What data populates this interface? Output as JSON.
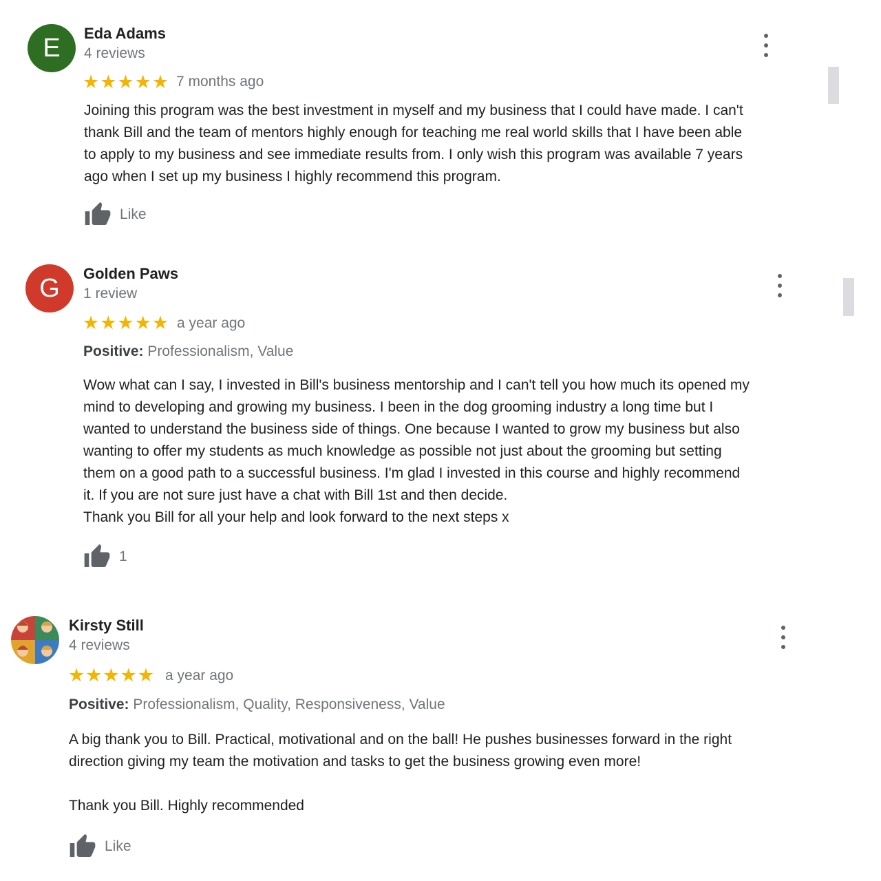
{
  "colors": {
    "star": "#f4b400",
    "secondary_text": "#70757a",
    "avatar_e": "#2e7d32",
    "avatar_g": "#d93025"
  },
  "reviews": [
    {
      "avatar_letter": "E",
      "name": "Eda Adams",
      "review_count": "4 reviews",
      "stars": "★★★★★",
      "rating": 5,
      "time": "7 months ago",
      "text": "Joining this program was the best investment in myself and my business that I could have made. I can't\nthank Bill and the team of mentors highly enough for teaching me real world skills that I have been able\nto apply to my business and see immediate results from. I only wish this program was available 7 years\nago when I set up my business I highly recommend this program.",
      "like_label": "Like",
      "menu_icon": "more-vert-icon",
      "like_icon": "thumb-up-icon"
    },
    {
      "avatar_letter": "G",
      "name": "Golden Paws",
      "review_count": "1 review",
      "stars": "★★★★★",
      "rating": 5,
      "time": "a year ago",
      "positive_label": "Positive:",
      "positive_values": "Professionalism, Value",
      "text": "Wow what can I say, I invested in Bill's business mentorship and I can't tell you how much its opened my\nmind to developing and growing my business. I been in the dog grooming industry a long time but I\nwanted to understand the business side of things. One because I wanted to grow my business but also\nwanting to offer my students as much knowledge as possible not just about the grooming but setting\nthem on a good path to a successful business. I'm glad I invested in this course and highly recommend\nit. If you are not sure just have a chat with Bill 1st and then decide.\nThank you Bill for all your help and look forward to the next steps x",
      "like_label": "1",
      "menu_icon": "more-vert-icon",
      "like_icon": "thumb-up-icon"
    },
    {
      "name": "Kirsty Still",
      "review_count": "4 reviews",
      "stars": "★★★★★",
      "rating": 5,
      "time": "a year ago",
      "positive_label": "Positive:",
      "positive_values": "Professionalism, Quality, Responsiveness, Value",
      "text": "A big thank you to Bill. Practical, motivational and on the ball! He pushes businesses forward in the right\ndirection giving my team the motivation and tasks to get the business growing even more!\n\nThank you Bill. Highly recommended",
      "like_label": "Like",
      "menu_icon": "more-vert-icon",
      "like_icon": "thumb-up-icon"
    }
  ]
}
